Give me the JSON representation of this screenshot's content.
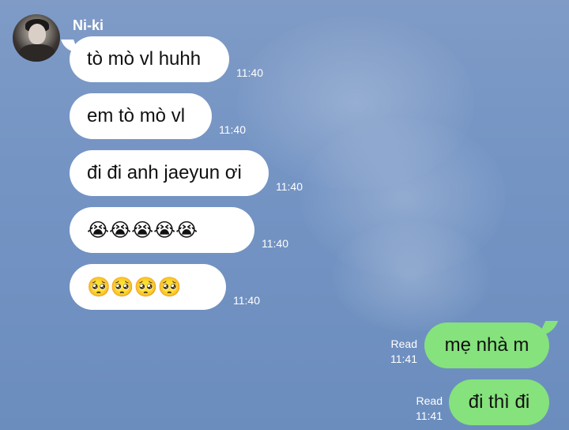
{
  "chat": {
    "sender": "Ni-ki",
    "incoming": [
      {
        "text": "tò mò vl huhh",
        "time": "11:40"
      },
      {
        "text": "em tò mò vl",
        "time": "11:40"
      },
      {
        "text": "đi đi anh jaeyun ơi",
        "time": "11:40"
      },
      {
        "text": "😭😭😭😭😭",
        "time": "11:40"
      },
      {
        "text": "🥺🥺🥺🥺",
        "time": "11:40"
      }
    ],
    "outgoing": [
      {
        "text": "mẹ nhà m",
        "status": "Read",
        "time": "11:41"
      },
      {
        "text": "đi thì đi",
        "status": "Read",
        "time": "11:41"
      }
    ]
  },
  "colors": {
    "background": "#7494c4",
    "incoming_bubble": "#ffffff",
    "outgoing_bubble": "#85e27c"
  }
}
